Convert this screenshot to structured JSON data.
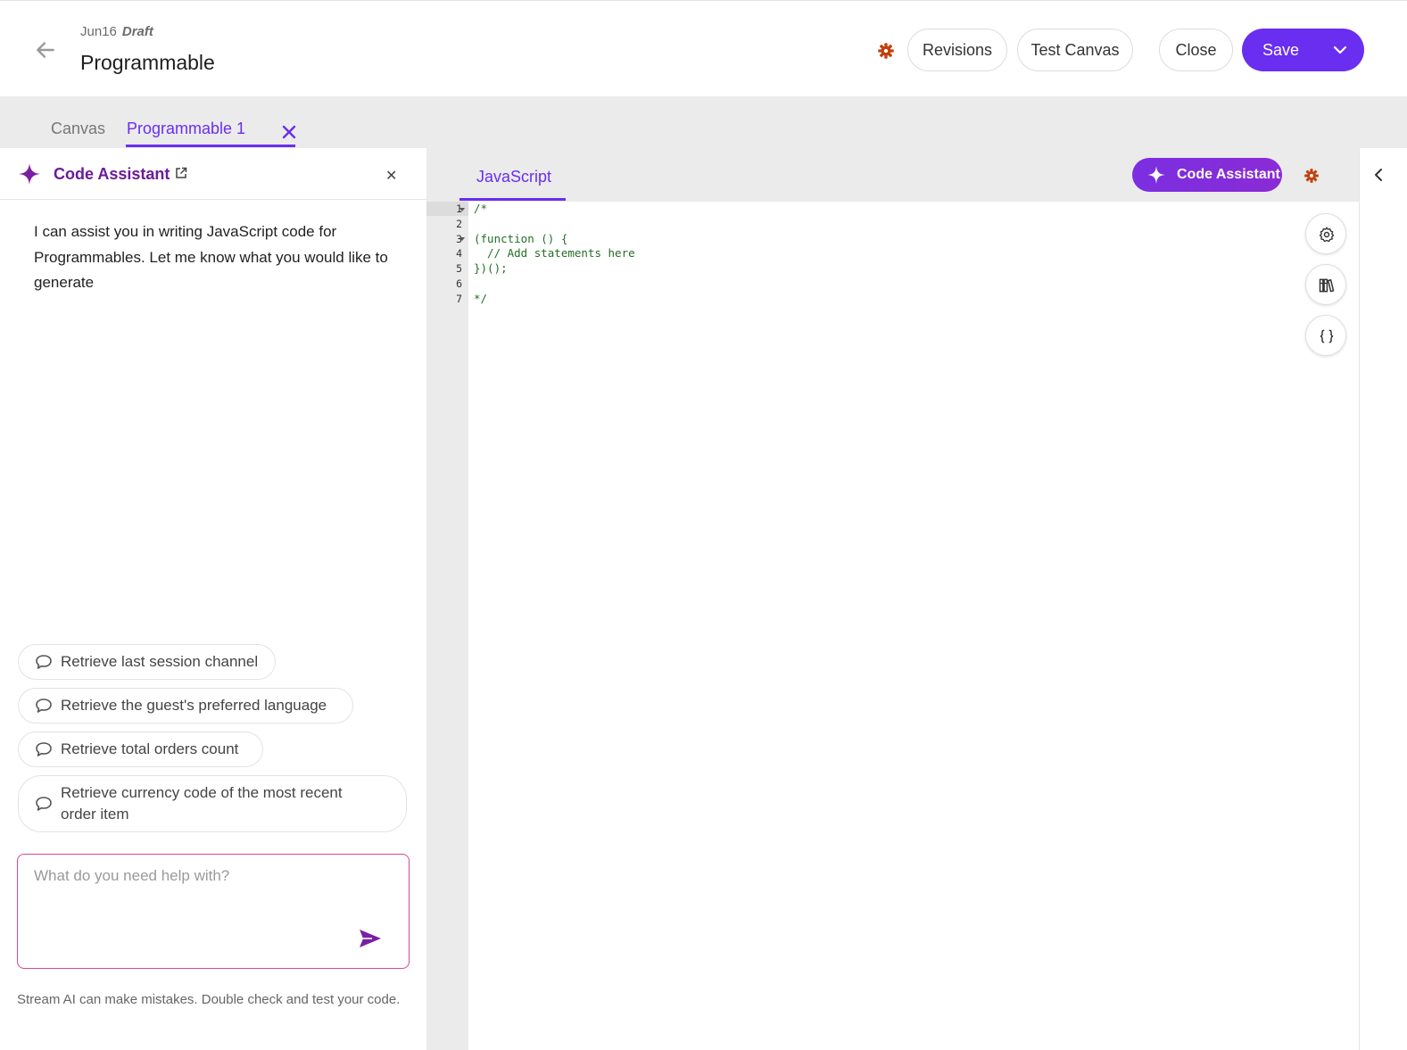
{
  "header": {
    "date": "Jun16",
    "status": "Draft",
    "title": "Programmable",
    "buttons": {
      "revisions": "Revisions",
      "test_canvas": "Test Canvas",
      "close": "Close",
      "save": "Save"
    },
    "accent": "#6a2ef0",
    "gear_color": "#c2410c"
  },
  "tabs": [
    {
      "label": "Canvas",
      "active": false
    },
    {
      "label": "Programmable 1",
      "active": true
    }
  ],
  "assistant": {
    "title": "Code Assistant",
    "intro": "I can assist you in writing JavaScript code for Programmables. Let me know what you would like to generate",
    "suggestions": [
      "Retrieve last session channel",
      "Retrieve the guest's preferred language",
      "Retrieve total orders count",
      "Retrieve currency code of the most recent order item"
    ],
    "input_placeholder": "What do you need help with?",
    "input_value": "",
    "disclaimer": "Stream AI can make mistakes. Double check and test your code."
  },
  "editor": {
    "tab": "JavaScript",
    "assistant_button": "Code Assistant",
    "line_numbers": [
      "1",
      "2",
      "3",
      "4",
      "5",
      "6",
      "7"
    ],
    "code_lines": [
      "/*",
      "",
      "(function () {",
      "  // Add statements here",
      "})();",
      "",
      "*/"
    ]
  }
}
